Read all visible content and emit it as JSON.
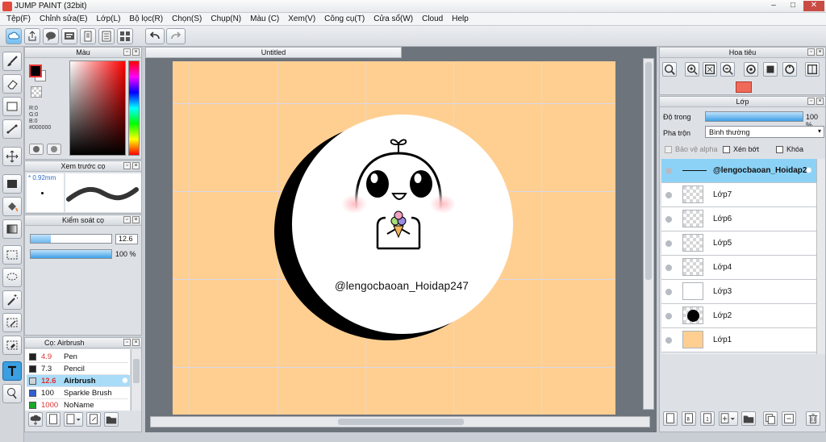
{
  "window": {
    "title": "JUMP PAINT (32bit)"
  },
  "menu": [
    "Tệp(F)",
    "Chỉnh sửa(E)",
    "Lớp(L)",
    "Bộ lọc(R)",
    "Chọn(S)",
    "Chụp(N)",
    "Màu (C)",
    "Xem(V)",
    "Công cụ(T)",
    "Cửa sổ(W)",
    "Cloud",
    "Help"
  ],
  "color_panel": {
    "title": "Màu",
    "r": "R:0",
    "g": "G:0",
    "b": "B:0",
    "hex": "#000000"
  },
  "preview_panel": {
    "title": "Xem trước cọ",
    "size": "0.92mm"
  },
  "control_panel": {
    "title": "Kiểm soát cọ",
    "size_value": "12.6",
    "opacity_value": "100 %"
  },
  "brush_panel": {
    "title": "Cọ: Airbrush",
    "brushes": [
      {
        "size": "4.9",
        "name": "Pen",
        "color": "#222222"
      },
      {
        "size": "7.3",
        "name": "Pencil",
        "color": "#222222"
      },
      {
        "size": "12.6",
        "name": "Airbrush",
        "color": "#cfd3d8"
      },
      {
        "size": "100",
        "name": "Sparkle Brush",
        "color": "#2f5fd0"
      },
      {
        "size": "1000",
        "name": "NoName",
        "color": "#1aa82a"
      }
    ]
  },
  "document": {
    "tab": "Untitled",
    "artwork_text": "@lengocbaoan_Hoidap247"
  },
  "navigator": {
    "title": "Hoa tiêu"
  },
  "layers_panel": {
    "title": "Lớp",
    "opacity_label": "Độ trong",
    "opacity_value": "100 %",
    "blend_label": "Pha trộn",
    "blend_value": "Bình thường",
    "protect_alpha": "Bảo vệ alpha",
    "clip": "Xén bớt",
    "lock": "Khóa",
    "layers": [
      {
        "name": "@lengocbaoan_Hoidap2"
      },
      {
        "name": "Lớp7"
      },
      {
        "name": "Lớp6"
      },
      {
        "name": "Lớp5"
      },
      {
        "name": "Lớp4"
      },
      {
        "name": "Lớp3"
      },
      {
        "name": "Lớp2"
      },
      {
        "name": "Lớp1"
      }
    ]
  },
  "colors": {
    "accent": "#3b9fe0",
    "canvas_bg": "#ffcf92",
    "selected_layer": "#8cd2f7"
  }
}
